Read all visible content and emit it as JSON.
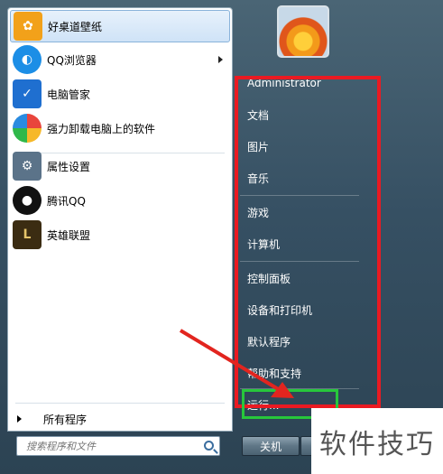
{
  "pinned": [
    {
      "label": "好桌道壁纸",
      "icon": "wallpaper-icon",
      "color": "#f2a11a"
    },
    {
      "label": "QQ浏览器",
      "icon": "qq-browser-icon",
      "color": "#1c8ee6",
      "submenu": true
    },
    {
      "label": "电脑管家",
      "icon": "shield-icon",
      "color": "#1f6fd0"
    },
    {
      "label": "强力卸载电脑上的软件",
      "icon": "uninstall-icon",
      "color": "#e9453c"
    },
    {
      "label": "属性设置",
      "icon": "settings-icon",
      "color": "#5b7389"
    },
    {
      "label": "腾讯QQ",
      "icon": "qq-penguin-icon",
      "color": "#111111"
    },
    {
      "label": "英雄联盟",
      "icon": "league-icon",
      "color": "#3b2c12"
    }
  ],
  "all_programs": "所有程序",
  "search": {
    "placeholder": "搜索程序和文件"
  },
  "right": {
    "user": "Administrator",
    "docs": "文档",
    "pictures": "图片",
    "music": "音乐",
    "games": "游戏",
    "computer": "计算机",
    "control_panel": "控制面板",
    "devices": "设备和打印机",
    "default_programs": "默认程序",
    "help": "帮助和支持",
    "run": "运行..."
  },
  "shutdown": "关机",
  "watermark": "软件技巧",
  "colors": {
    "highlight_red": "#ea1a22",
    "highlight_green": "#27c73b",
    "arrow": "#e2251f"
  }
}
